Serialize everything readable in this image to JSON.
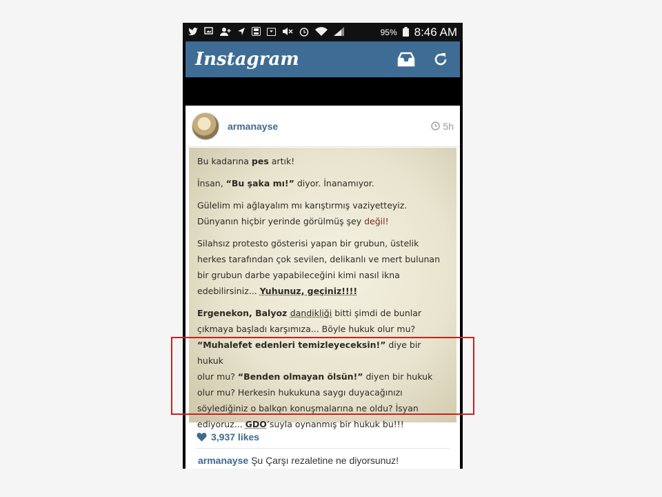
{
  "status_bar": {
    "battery": "95%",
    "time": "8:46 AM",
    "icons": [
      "twitter-icon",
      "image-icon",
      "add-contact-icon",
      "navigation-icon",
      "save-icon",
      "download-icon",
      "mute-icon",
      "alarm-icon",
      "wifi-icon",
      "signal-icon",
      "battery-icon"
    ]
  },
  "app_bar": {
    "title": "Instagram",
    "icons": [
      "inbox-icon",
      "refresh-icon"
    ]
  },
  "post": {
    "username": "armanayse",
    "time": "5h",
    "likes": "3,937 likes",
    "caption_user": "armanayse",
    "caption_text": "Şu Çarşı rezaletine ne diyorsunuz!",
    "image_text": {
      "p1": {
        "a": "Bu kadarına ",
        "b": "pes",
        "c": " artık!"
      },
      "p2": {
        "a": "İnsan, ",
        "b": "“Bu şaka mı!”",
        "c": " diyor. İnanamıyor."
      },
      "p3": {
        "line1": "Gülelim mi ağlayalım mı karıştırmış vaziyetteyiz.",
        "line2a": "Dünyanın hiçbir yerinde görülmüş şey ",
        "line2b": "değil!"
      },
      "p4": {
        "line1": "Silahsız protesto gösterisi yapan bir grubun, üstelik",
        "line2": "herkes tarafından çok sevilen, delikanlı ve mert bulunan",
        "line3": "bir grubun darbe yapabileceğini kimi nasıl ikna",
        "line4a": "edebilirsiniz... ",
        "line4b": "Yuhunuz, geçiniz!!!!"
      },
      "p5": {
        "l1a": "Ergenekon, Balyoz ",
        "l1b": "dandikliği",
        "l1c": " bitti şimdi de bunlar",
        "l2": "çıkmaya başladı karşımıza... Böyle hukuk olur mu?",
        "l3a": "“Muhalefet edenleri temizleyeceksin!”",
        "l3b": " diye bir hukuk",
        "l4a": "olur mu? ",
        "l4b": "“Benden olmayan ölsün!”",
        "l4c": " diyen bir hukuk",
        "l5": "olur mu? Herkesin hukukuna saygı duyacağınızı",
        "l6": "söylediğiniz o balkon konuşmalarına ne oldu? İsyan",
        "l7a": "ediyoruz... ",
        "l7b": "GDO",
        "l7c": "’suyla oynanmış bir hukuk bu!!!"
      },
      "cursor": "I"
    }
  },
  "colors": {
    "app_bar": "#3f6c94",
    "link_blue": "#3d6895",
    "highlight_red": "#d21c1c"
  }
}
